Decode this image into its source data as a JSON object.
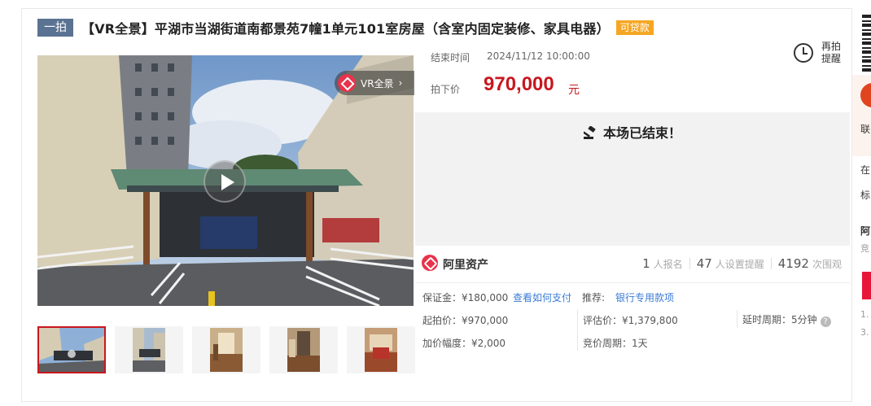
{
  "title": {
    "tag": "一拍",
    "text": "【VR全景】平湖市当湖街道南都景苑7幢1单元101室房屋（含室内固定装修、家具电器）",
    "loan_tag": "可贷款"
  },
  "gallery": {
    "vr_badge": "VR全景",
    "thumb_count": 5
  },
  "auction": {
    "end_time_label": "结束时间",
    "end_time": "2024/11/12 10:00:00",
    "sold_price_label": "拍下价",
    "sold_price": "970,000",
    "price_unit": "元",
    "remind_label": "再拍提醒",
    "ended_text": "本场已结束！"
  },
  "platform": {
    "name": "阿里资产",
    "signups": "1",
    "signups_label": "人报名",
    "reminders": "47",
    "reminders_label": "人设置提醒",
    "views": "4192",
    "views_label": "次围观"
  },
  "details": {
    "deposit_label": "保证金：¥180,000",
    "pay_link": "查看如何支付",
    "recommend_label": "推荐:",
    "recommend_link": "银行专用款项",
    "start_price": "起拍价：¥970,000",
    "appraisal": "评估价：¥1,379,800",
    "delay": "延时周期：5分钟",
    "increment": "加价幅度：¥2,000",
    "cycle": "竞价周期：1天"
  },
  "sidebar": {
    "t1": "联",
    "t2": "在",
    "t3": "标",
    "t4": "阿",
    "t5": "竞",
    "t6": "1.",
    "t7": "3."
  },
  "colors": {
    "price_red": "#c8171e",
    "tag_blue": "#5b7393",
    "loan_orange": "#f5a623",
    "link_blue": "#3a7bd5"
  }
}
